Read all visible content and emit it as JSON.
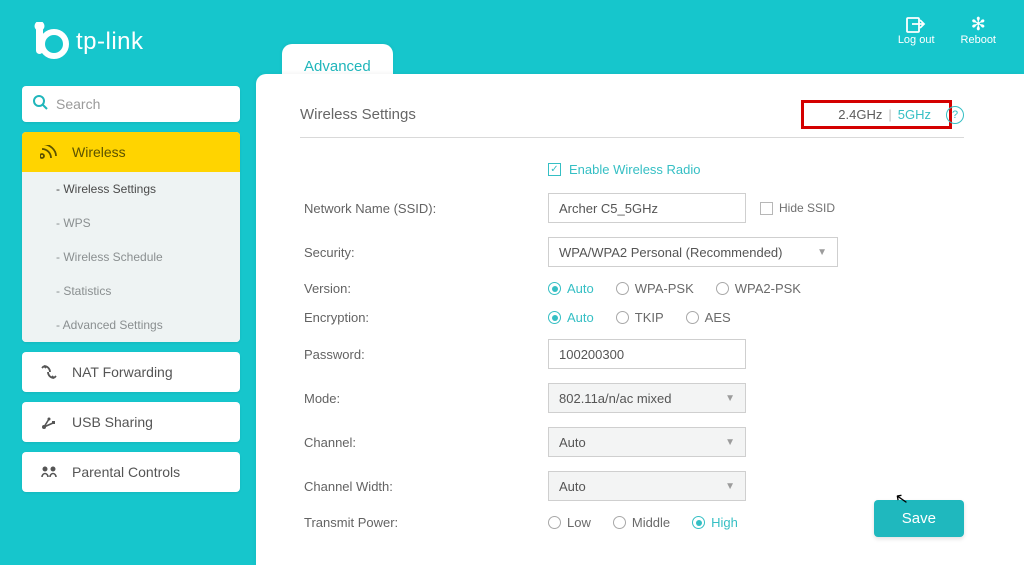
{
  "brand": "tp-link",
  "topActions": {
    "logout": "Log out",
    "reboot": "Reboot"
  },
  "search": {
    "placeholder": "Search"
  },
  "nav": {
    "wireless": {
      "label": "Wireless",
      "items": [
        {
          "label": "- Wireless Settings",
          "active": true
        },
        {
          "label": "- WPS"
        },
        {
          "label": "- Wireless Schedule"
        },
        {
          "label": "- Statistics"
        },
        {
          "label": "- Advanced Settings"
        }
      ]
    },
    "nat": "NAT Forwarding",
    "usb": "USB Sharing",
    "parental": "Parental Controls"
  },
  "tab": "Advanced",
  "section": {
    "title": "Wireless Settings",
    "band24": "2.4GHz",
    "band5": "5GHz"
  },
  "form": {
    "enable": "Enable Wireless Radio",
    "ssid": {
      "label": "Network Name (SSID):",
      "value": "Archer C5_5GHz",
      "hide": "Hide SSID"
    },
    "security": {
      "label": "Security:",
      "value": "WPA/WPA2 Personal (Recommended)"
    },
    "version": {
      "label": "Version:",
      "options": [
        "Auto",
        "WPA-PSK",
        "WPA2-PSK"
      ],
      "selected": "Auto"
    },
    "encryption": {
      "label": "Encryption:",
      "options": [
        "Auto",
        "TKIP",
        "AES"
      ],
      "selected": "Auto"
    },
    "password": {
      "label": "Password:",
      "value": "100200300"
    },
    "mode": {
      "label": "Mode:",
      "value": "802.11a/n/ac mixed"
    },
    "channel": {
      "label": "Channel:",
      "value": "Auto"
    },
    "channelWidth": {
      "label": "Channel Width:",
      "value": "Auto"
    },
    "power": {
      "label": "Transmit Power:",
      "options": [
        "Low",
        "Middle",
        "High"
      ],
      "selected": "High"
    },
    "save": "Save"
  }
}
